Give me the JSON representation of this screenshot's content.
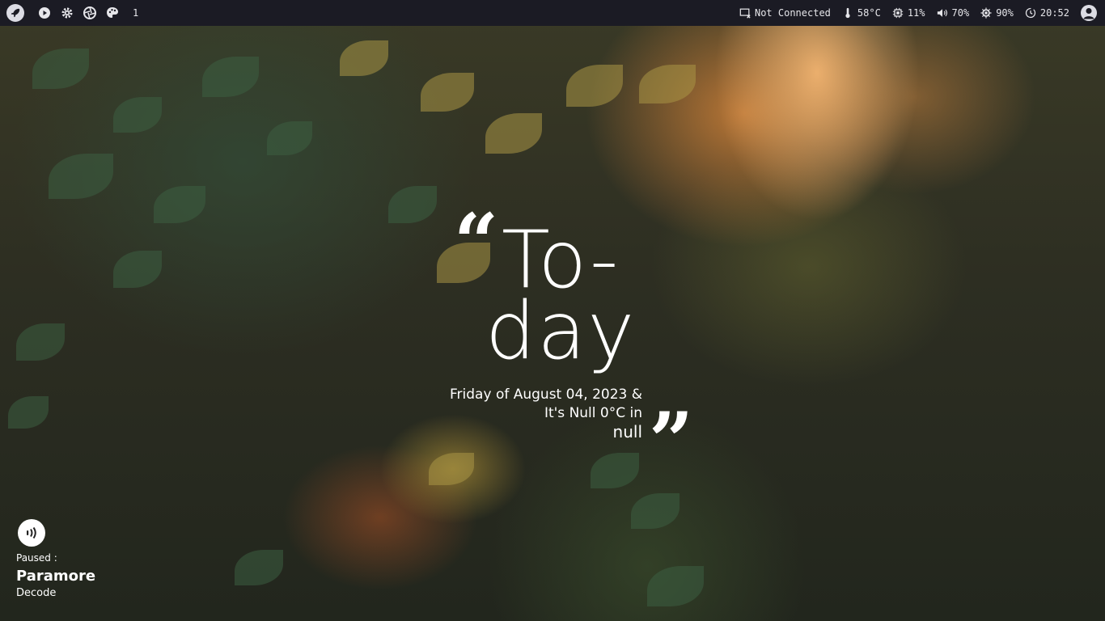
{
  "topbar": {
    "left_icons": [
      "rocket-icon",
      "play-icon",
      "gear-icon",
      "aperture-icon",
      "palette-icon"
    ],
    "workspace": "1",
    "network": {
      "icon": "monitor-disconnected-icon",
      "label": "Not Connected"
    },
    "temperature": {
      "icon": "thermometer-icon",
      "label": "58°C"
    },
    "cpu": {
      "icon": "cpu-icon",
      "label": "11%"
    },
    "volume": {
      "icon": "speaker-icon",
      "label": "70%"
    },
    "brightness": {
      "icon": "brightness-icon",
      "label": "90%"
    },
    "clock": {
      "icon": "clock-icon",
      "label": "20:52"
    },
    "user": {
      "icon": "user-icon"
    }
  },
  "center": {
    "quote_open": "“",
    "quote_close": "”",
    "title_line1": "To-",
    "title_line2": "day",
    "subtitle_line1": "Friday of August 04, 2023 &",
    "subtitle_line2": "It's Null 0°C in",
    "subtitle_line3": "null"
  },
  "media": {
    "icon": "media-player-icon",
    "status": "Paused :",
    "artist": "Paramore",
    "track": "Decode"
  }
}
